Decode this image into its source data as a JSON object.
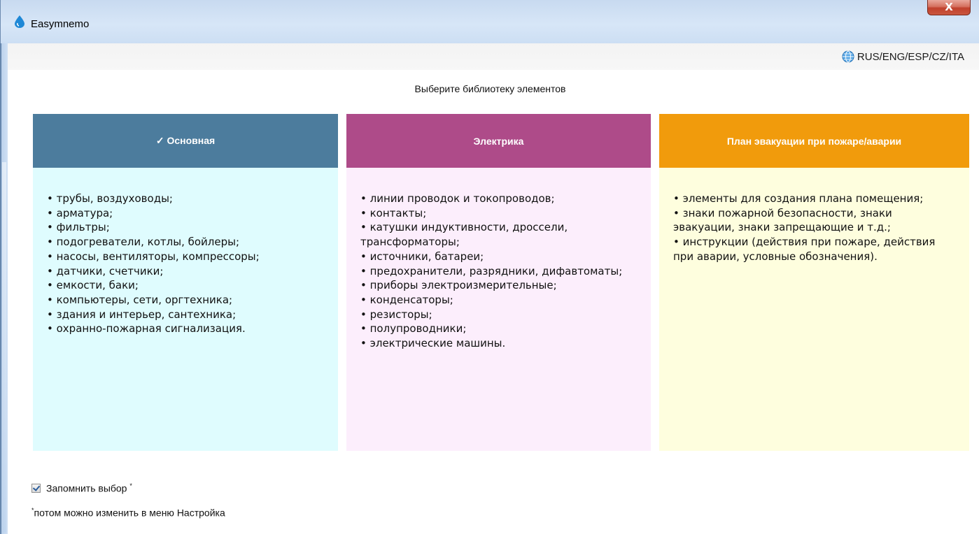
{
  "window": {
    "title": "Easymnemo",
    "close_label": "X"
  },
  "toolbar": {
    "language_label": "RUS/ENG/ESP/CZ/ITA"
  },
  "heading": "Выберите библиотеку элементов",
  "libraries": [
    {
      "title": "✓ Основная",
      "color": "#4c7c9d",
      "body_color": "#dffcfe",
      "items": [
        "трубы, воздуховоды;",
        "арматура;",
        "фильтры;",
        "подогреватели, котлы, бойлеры;",
        "насосы, вентиляторы, компрессоры;",
        "датчики, счетчики;",
        "емкости, баки;",
        "компьютеры, сети, оргтехника;",
        "здания и интерьер, сантехника;",
        "охранно-пожарная сигнализация."
      ]
    },
    {
      "title": "Электрика",
      "color": "#ae4b89",
      "body_color": "#fceefc",
      "items": [
        "линии проводок и токопроводов;",
        "контакты;",
        "катушки индуктивности, дроссели, трансформаторы;",
        "источники, батареи;",
        "предохранители, разрядники, дифавтоматы;",
        "приборы электроизмерительные;",
        "конденсаторы;",
        "резисторы;",
        "полупроводники;",
        "электрические машины."
      ]
    },
    {
      "title": "План эвакуации при пожаре/аварии",
      "color": "#f19b0c",
      "body_color": "#fefede",
      "items": [
        "элементы для создания плана помещения;",
        "знаки пожарной безопасности, знаки эвакуации, знаки запрещающие и т.д.;",
        "инструкции (действия при пожаре, действия при аварии, условные обозначения)."
      ]
    }
  ],
  "remember": {
    "label": "Запомнить выбор",
    "mark": "*",
    "checked": true
  },
  "note": {
    "mark": "*",
    "text": "потом можно изменить в меню Настройка"
  },
  "icons": {
    "app": "water-drop-icon",
    "language": "globe-icon"
  }
}
